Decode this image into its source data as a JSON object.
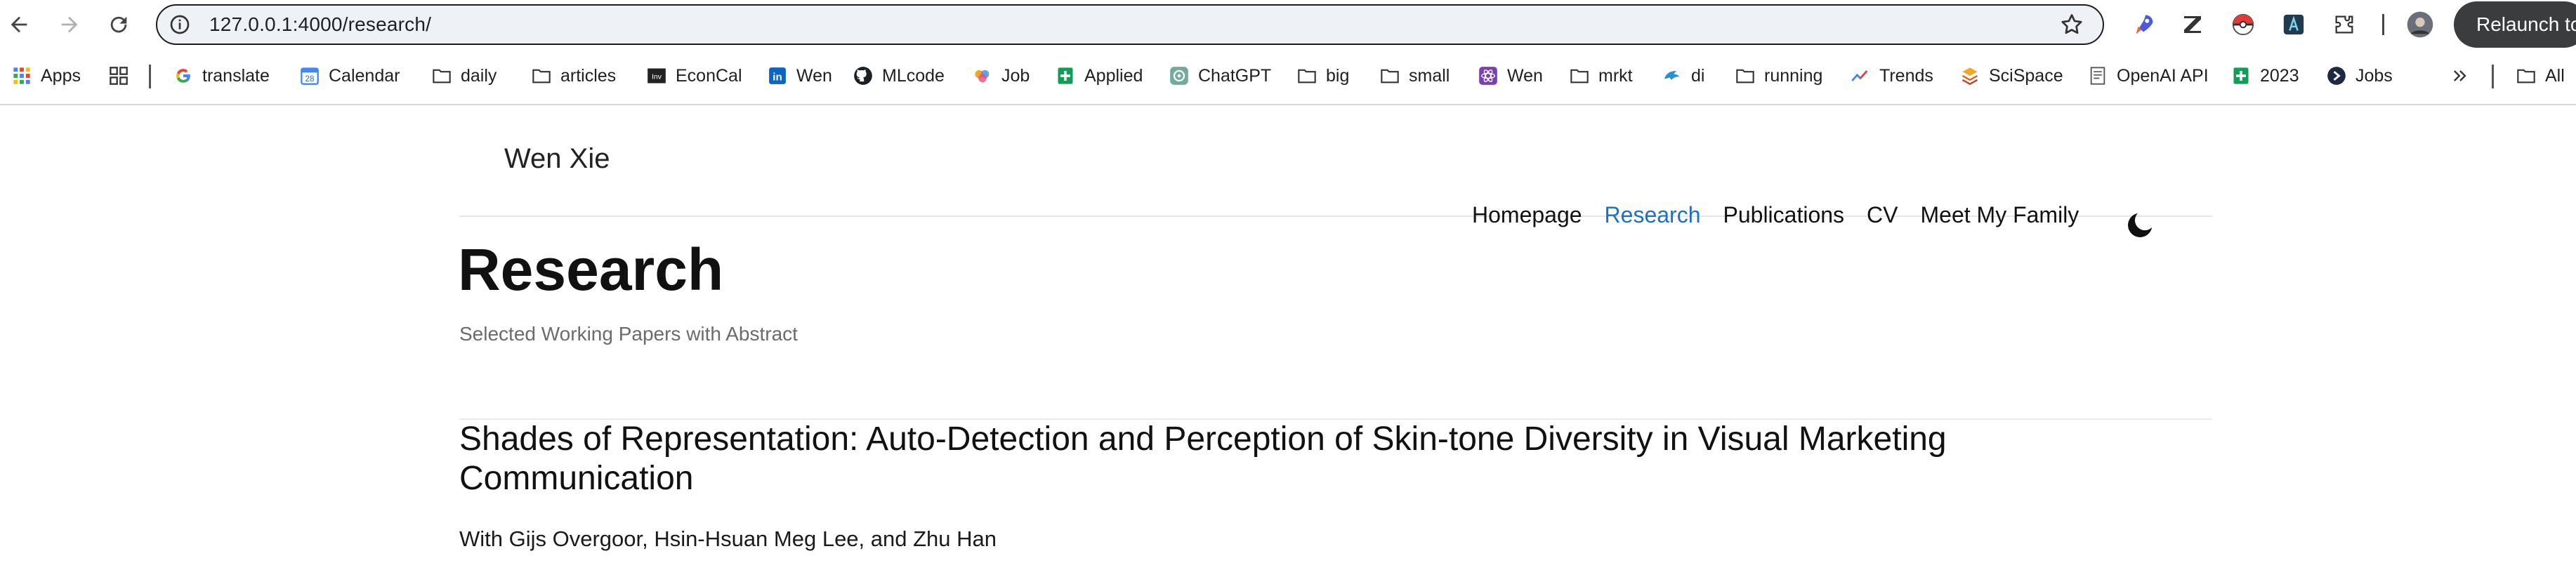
{
  "browser": {
    "url": "127.0.0.1:4000/research/",
    "relaunch_label": "Relaunch to"
  },
  "bookmarks": [
    {
      "label": "Apps",
      "icon": "apps-grid-icon"
    },
    {
      "label": "translate",
      "icon": "google-icon"
    },
    {
      "label": "Calendar",
      "icon": "calendar-icon"
    },
    {
      "label": "daily",
      "icon": "folder-icon"
    },
    {
      "label": "articles",
      "icon": "folder-icon"
    },
    {
      "label": "EconCal",
      "icon": "investing-icon"
    },
    {
      "label": "Wen",
      "icon": "linkedin-icon"
    },
    {
      "label": "MLcode",
      "icon": "github-icon"
    },
    {
      "label": "Job",
      "icon": "job-icon"
    },
    {
      "label": "Applied",
      "icon": "sheets-icon"
    },
    {
      "label": "ChatGPT",
      "icon": "chatgpt-icon"
    },
    {
      "label": "big",
      "icon": "folder-icon"
    },
    {
      "label": "small",
      "icon": "folder-icon"
    },
    {
      "label": "Wen",
      "icon": "react-icon"
    },
    {
      "label": "mrkt",
      "icon": "folder-icon"
    },
    {
      "label": "di",
      "icon": "di-icon"
    },
    {
      "label": "running",
      "icon": "folder-icon"
    },
    {
      "label": "Trends",
      "icon": "trends-icon"
    },
    {
      "label": "SciSpace",
      "icon": "scispace-icon"
    },
    {
      "label": "OpenAI API",
      "icon": "doc-icon"
    },
    {
      "label": "2023",
      "icon": "sheets-icon"
    },
    {
      "label": "Jobs",
      "icon": "jobs-icon"
    },
    {
      "label": "All",
      "icon": "folder-icon"
    }
  ],
  "site": {
    "title": "Wen Xie",
    "nav": [
      "Homepage",
      "Research",
      "Publications",
      "CV",
      "Meet My Family"
    ],
    "active_nav": "Research"
  },
  "page": {
    "title": "Research",
    "description": "Selected Working Papers with Abstract"
  },
  "papers": [
    {
      "title": "Shades of Representation: Auto-Detection and Perception of Skin-tone Diversity in Visual Marketing Communication",
      "authors": "With Gijs Overgoor, Hsin-Hsuan Meg Lee, and Zhu Han"
    }
  ],
  "colors": {
    "accent": "#1c6fcf",
    "relaunch_bg": "#3b3c3e",
    "omnibox_bg": "#eef1f6"
  }
}
